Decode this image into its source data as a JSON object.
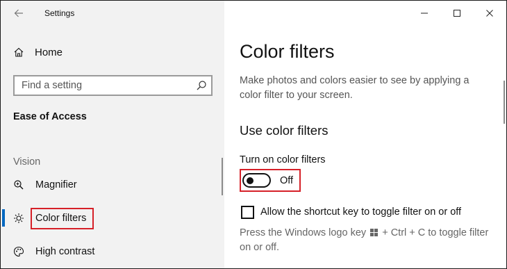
{
  "window": {
    "title": "Settings"
  },
  "sidebar": {
    "home_label": "Home",
    "search_placeholder": "Find a setting",
    "category": "Ease of Access",
    "section": "Vision",
    "items": [
      {
        "label": "Magnifier",
        "icon": "magnifier-icon"
      },
      {
        "label": "Color filters",
        "icon": "brightness-icon",
        "selected": true
      },
      {
        "label": "High contrast",
        "icon": "palette-icon"
      }
    ]
  },
  "main": {
    "title": "Color filters",
    "description": "Make photos and colors easier to see by applying a color filter to your screen.",
    "section_title": "Use color filters",
    "toggle": {
      "label": "Turn on color filters",
      "state_text": "Off",
      "on": false
    },
    "checkbox": {
      "label": "Allow the shortcut key to toggle filter on or off",
      "checked": false
    },
    "hint": {
      "before": "Press the Windows logo key",
      "after": "+ Ctrl + C to toggle filter on or off."
    }
  },
  "colors": {
    "accent": "#0067c0",
    "highlight_box": "#d62028",
    "sidebar_bg": "#f2f2f2"
  }
}
